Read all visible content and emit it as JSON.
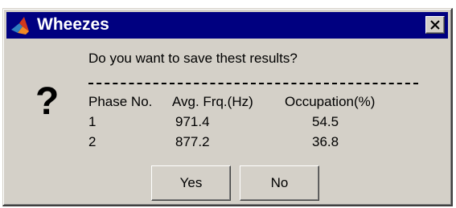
{
  "window": {
    "title": "Wheezes",
    "icon": "matlab-icon",
    "close_icon": "close-icon"
  },
  "dialog": {
    "icon": "question-icon",
    "icon_glyph": "?",
    "message": "Do you want to save thest results?",
    "table": {
      "headers": [
        "Phase No.",
        "Avg. Frq.(Hz)",
        "Occupation(%)"
      ],
      "rows": [
        [
          "1",
          "971.4",
          "54.5"
        ],
        [
          "2",
          "877.2",
          "36.8"
        ]
      ]
    }
  },
  "buttons": {
    "yes_label": "Yes",
    "no_label": "No"
  },
  "colors": {
    "titlebar": "#000080",
    "dialog_bg": "#d4d0c8"
  }
}
